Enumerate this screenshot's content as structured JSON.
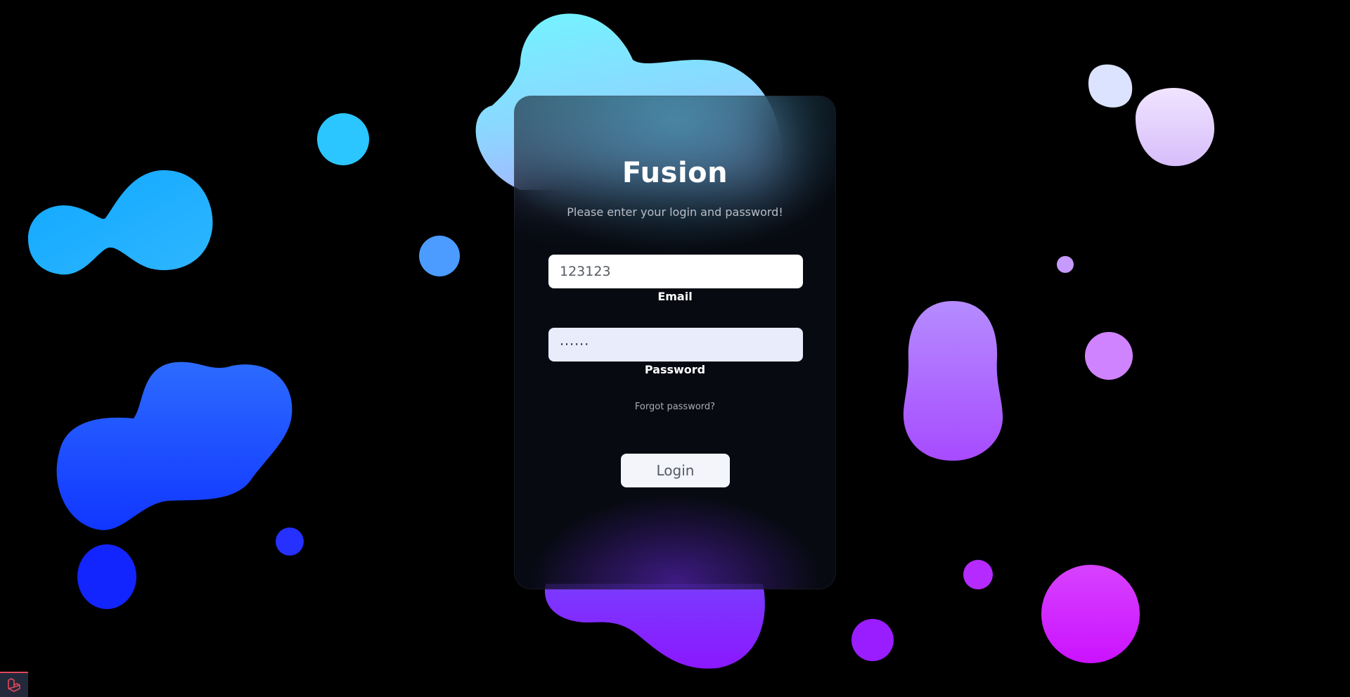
{
  "app": {
    "title": "Fusion",
    "subtitle": "Please enter your login and password!"
  },
  "form": {
    "email": {
      "value": "123123",
      "label": "Email"
    },
    "password": {
      "value": "······",
      "label": "Password"
    },
    "forgot_link": "Forgot password?",
    "submit_label": "Login"
  },
  "colors": {
    "background": "#000000",
    "card": "#0c101c",
    "accent_cyan": "#5ee6ff",
    "accent_blue": "#1f5bff",
    "accent_purple": "#a94dff",
    "accent_magenta": "#e21aff",
    "badge_red": "#e0475a"
  },
  "icons": {
    "corner_badge": "laravel-logo-icon"
  }
}
